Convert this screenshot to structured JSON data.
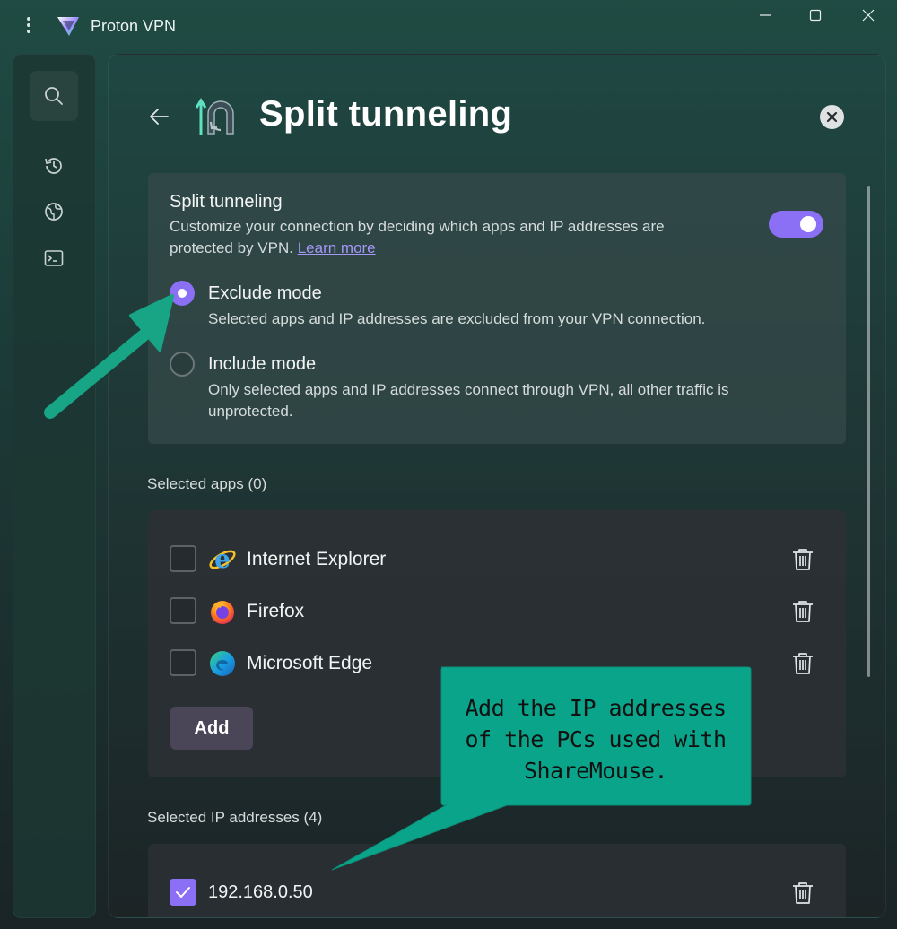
{
  "window": {
    "title": "Proton VPN",
    "menu_icon": "more-vertical-icon",
    "controls": [
      "minimize-icon",
      "maximize-icon",
      "close-icon"
    ]
  },
  "sidebar": {
    "items": [
      {
        "icon": "search-icon"
      },
      {
        "icon": "history-icon"
      },
      {
        "icon": "globe-icon"
      },
      {
        "icon": "terminal-icon"
      }
    ]
  },
  "page": {
    "title": "Split tunneling",
    "back_icon": "arrow-left-icon",
    "close_icon": "close-circle-icon"
  },
  "split": {
    "title": "Split tunneling",
    "description": "Customize your connection by deciding which apps and IP addresses are protected by VPN.",
    "learn_more": "Learn more",
    "enabled": true
  },
  "modes": {
    "exclude": {
      "label": "Exclude mode",
      "description": "Selected apps and IP addresses are excluded from your VPN connection.",
      "selected": true
    },
    "include": {
      "label": "Include mode",
      "description": "Only selected apps and IP addresses connect through VPN, all other traffic is unprotected.",
      "selected": false
    }
  },
  "apps": {
    "header": "Selected apps (0)",
    "items": [
      {
        "label": "Internet Explorer",
        "icon": "internet-explorer-icon",
        "checked": false
      },
      {
        "label": "Firefox",
        "icon": "firefox-icon",
        "checked": false
      },
      {
        "label": "Microsoft Edge",
        "icon": "edge-icon",
        "checked": false
      }
    ],
    "add_label": "Add"
  },
  "ips": {
    "header": "Selected IP addresses (4)",
    "items": [
      {
        "label": "192.168.0.50",
        "checked": true
      }
    ]
  },
  "annotation": {
    "callout_text": "Add the IP addresses of the PCs used with ShareMouse.",
    "callout_color": "#0aa48a",
    "arrow_color": "#17a586"
  },
  "colors": {
    "accent": "#8b70f5",
    "link": "#a596f7"
  }
}
